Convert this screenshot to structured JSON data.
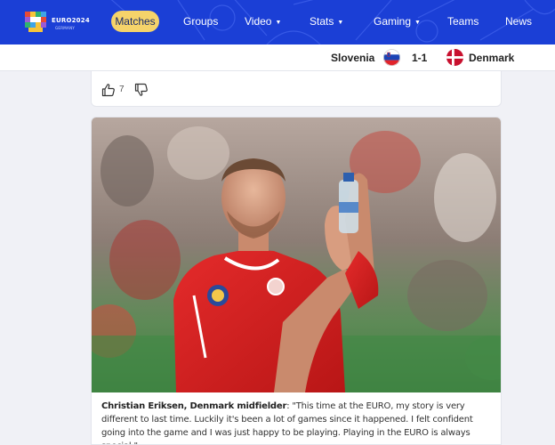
{
  "brand": {
    "title": "EURO2024",
    "subtitle": "GERMANY"
  },
  "nav": {
    "items": [
      {
        "label": "Matches",
        "active": true,
        "dropdown": false
      },
      {
        "label": "Groups",
        "active": false,
        "dropdown": false
      },
      {
        "label": "Video",
        "active": false,
        "dropdown": true
      },
      {
        "label": "Stats",
        "active": false,
        "dropdown": true
      },
      {
        "label": "Gaming",
        "active": false,
        "dropdown": true
      },
      {
        "label": "Teams",
        "active": false,
        "dropdown": false
      },
      {
        "label": "News",
        "active": false,
        "dropdown": false
      }
    ],
    "caret": "▼"
  },
  "score": {
    "home_team": "Slovenia",
    "away_team": "Denmark",
    "result": "1-1"
  },
  "reactions": {
    "likes": "7",
    "like_icon": "thumbs-up-icon",
    "dislike_icon": "thumbs-down-icon"
  },
  "article": {
    "caption_speaker": "Christian Eriksen, Denmark midfielder",
    "caption_quote": ": \"This time at the EURO, my story is very different to last time. Luckily it's been a lot of games since it happened. I felt confident going into the game and I was just happy to be playing. Playing in the EURO is always special.\""
  },
  "colors": {
    "nav_bg": "#1b3fd6",
    "active_pill": "#f5d36a",
    "denmark_red": "#c8102e"
  }
}
